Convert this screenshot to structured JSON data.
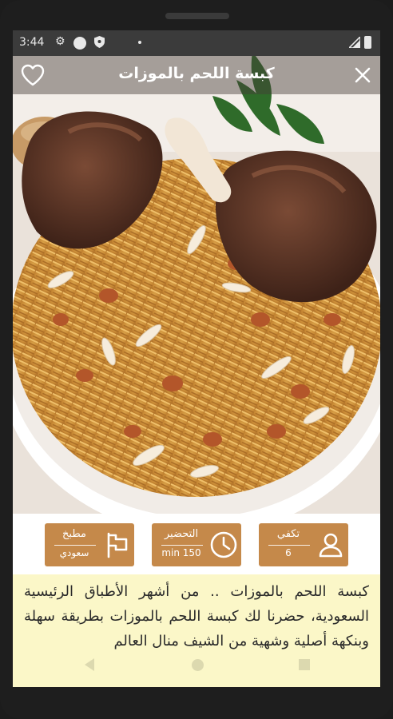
{
  "status_bar": {
    "time": "3:44"
  },
  "header": {
    "title": "كبسة اللحم بالموزات"
  },
  "info_cards": [
    {
      "label": "مطبخ",
      "value": "سعودي",
      "icon": "flag-icon"
    },
    {
      "label": "التحضير",
      "value": "150 min",
      "icon": "clock-icon"
    },
    {
      "label": "تكفي",
      "value": "6",
      "icon": "person-icon"
    }
  ],
  "description": "كبسة اللحم بالموزات .. من أشهر الأطباق الرئيسية السعودية، حضرنا لك كبسة اللحم بالموزات بطريقة سهلة وبنكهة أصلية وشهية من الشيف منال العالم",
  "colors": {
    "accent": "#c5894a",
    "description_bg": "#fbf7c8",
    "toolbar": "#463c37"
  }
}
